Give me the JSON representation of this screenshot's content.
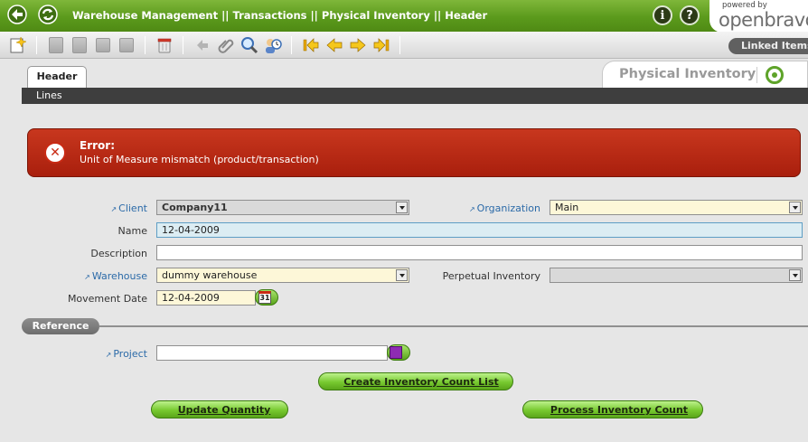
{
  "breadcrumb": "Warehouse Management || Transactions || Physical Inventory  || Header",
  "logo": {
    "powered_by": "powered by",
    "name": "openbravo"
  },
  "toolbar": {
    "linked_items": "Linked Items"
  },
  "tabs": {
    "header": "Header",
    "lines": "Lines"
  },
  "window_title": "Physical Inventory",
  "error": {
    "title": "Error:",
    "message": "Unit of Measure mismatch (product/transaction)"
  },
  "form": {
    "client": {
      "label": "Client",
      "value": "Company11"
    },
    "organization": {
      "label": "Organization",
      "value": "Main"
    },
    "name": {
      "label": "Name",
      "value": "12-04-2009"
    },
    "description": {
      "label": "Description",
      "value": ""
    },
    "warehouse": {
      "label": "Warehouse",
      "value": "dummy warehouse"
    },
    "perpetual_inventory": {
      "label": "Perpetual Inventory",
      "value": ""
    },
    "movement_date": {
      "label": "Movement Date",
      "value": "12-04-2009"
    },
    "calendar_day": "31"
  },
  "reference": {
    "section": "Reference",
    "project": {
      "label": "Project",
      "value": ""
    }
  },
  "buttons": {
    "create_count_list": "Create Inventory Count List",
    "update_quantity": "Update Quantity",
    "process_count": "Process Inventory Count"
  },
  "colors": {
    "topbar": "#5b9a1c",
    "error": "#b52814",
    "required_field": "#fdf7d8",
    "button_green": "#77c92f"
  }
}
